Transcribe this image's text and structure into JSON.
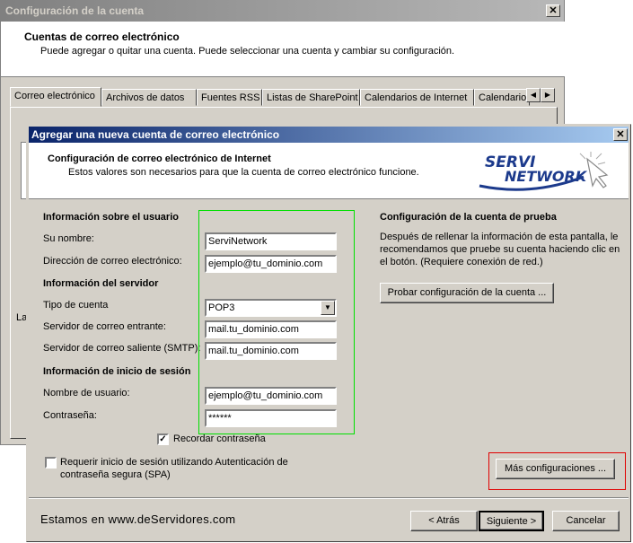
{
  "back_window": {
    "title": "Configuración de la cuenta",
    "heading": "Cuentas de correo electrónico",
    "description": "Puede agregar o quitar una cuenta. Puede seleccionar una cuenta y cambiar su configuración.",
    "tabs": [
      "Correo electrónico",
      "Archivos de datos",
      "Fuentes RSS",
      "Listas de SharePoint",
      "Calendarios de Internet",
      "Calendarios p"
    ],
    "left_edge_label": "La"
  },
  "dialog": {
    "title": "Agregar una nueva cuenta de correo electrónico",
    "header_title": "Configuración de correo electrónico de Internet",
    "header_desc": "Estos valores son necesarios para que la cuenta de correo electrónico funcione.",
    "logo_line1": "SERVI",
    "logo_line2": "NETWORK",
    "user_section": "Información sobre el usuario",
    "name_label": "Su nombre:",
    "name_value": "ServiNetwork",
    "email_label": "Dirección de correo electrónico:",
    "email_value": "ejemplo@tu_dominio.com",
    "server_section": "Información del servidor",
    "account_type_label": "Tipo de cuenta",
    "account_type_value": "POP3",
    "incoming_label": "Servidor de correo entrante:",
    "incoming_value": "mail.tu_dominio.com",
    "outgoing_label": "Servidor de correo saliente (SMTP):",
    "outgoing_value": "mail.tu_dominio.com",
    "login_section": "Información de inicio de sesión",
    "username_label": "Nombre de usuario:",
    "username_value": "ejemplo@tu_dominio.com",
    "password_label": "Contraseña:",
    "password_value": "******",
    "remember_label": "Recordar contraseña",
    "spa_label_1": "Requerir inicio de sesión utilizando Autenticación de",
    "spa_label_2": "contraseña segura (SPA)",
    "test_section": "Configuración de la cuenta de prueba",
    "test_desc_1": "Después de rellenar la información de esta pantalla, le",
    "test_desc_2": "recomendamos que pruebe su cuenta haciendo clic en",
    "test_desc_3": "el botón. (Requiere conexión de red.)",
    "test_button": "Probar configuración de la cuenta ...",
    "more_button": "Más configuraciones ...",
    "footer_text": "Estamos en www.deServidores.com",
    "back_button": "< Atrás",
    "next_button": "Siguiente >",
    "cancel_button": "Cancelar"
  },
  "colors": {
    "highlight_green": "#00e000",
    "highlight_red": "#e00000",
    "title_active": "#0a246a",
    "logo_blue": "#1c3a8c"
  }
}
